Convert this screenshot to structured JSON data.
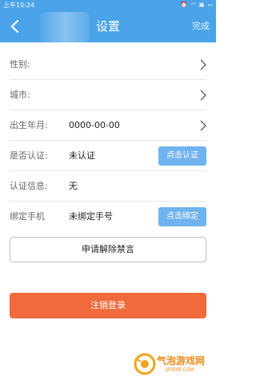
{
  "status_bar": {
    "time": "上午10:24",
    "icons": [
      "alarm-icon",
      "wifi-icon",
      "sim-icon",
      "battery-icon"
    ]
  },
  "nav": {
    "title": "设置",
    "done_label": "完成",
    "back_icon": "chevron-left-icon"
  },
  "rows": {
    "gender": {
      "label": "性别:"
    },
    "city": {
      "label": "城市:"
    },
    "birthday": {
      "label": "出生年月:",
      "value": "0000-00-00"
    },
    "verified": {
      "label": "是否认证:",
      "value": "未认证",
      "button": "点击认证"
    },
    "verify_info": {
      "label": "认证信息:",
      "value": "无"
    },
    "phone": {
      "label": "绑定手机",
      "value": "未绑定手号",
      "button": "点击绑定"
    }
  },
  "appeal_button": "申请解除禁言",
  "logout_button": "注销登录",
  "colors": {
    "primary": "#4aa3e8",
    "button_blue": "#6fb3ee",
    "danger": "#f16a3b"
  }
}
